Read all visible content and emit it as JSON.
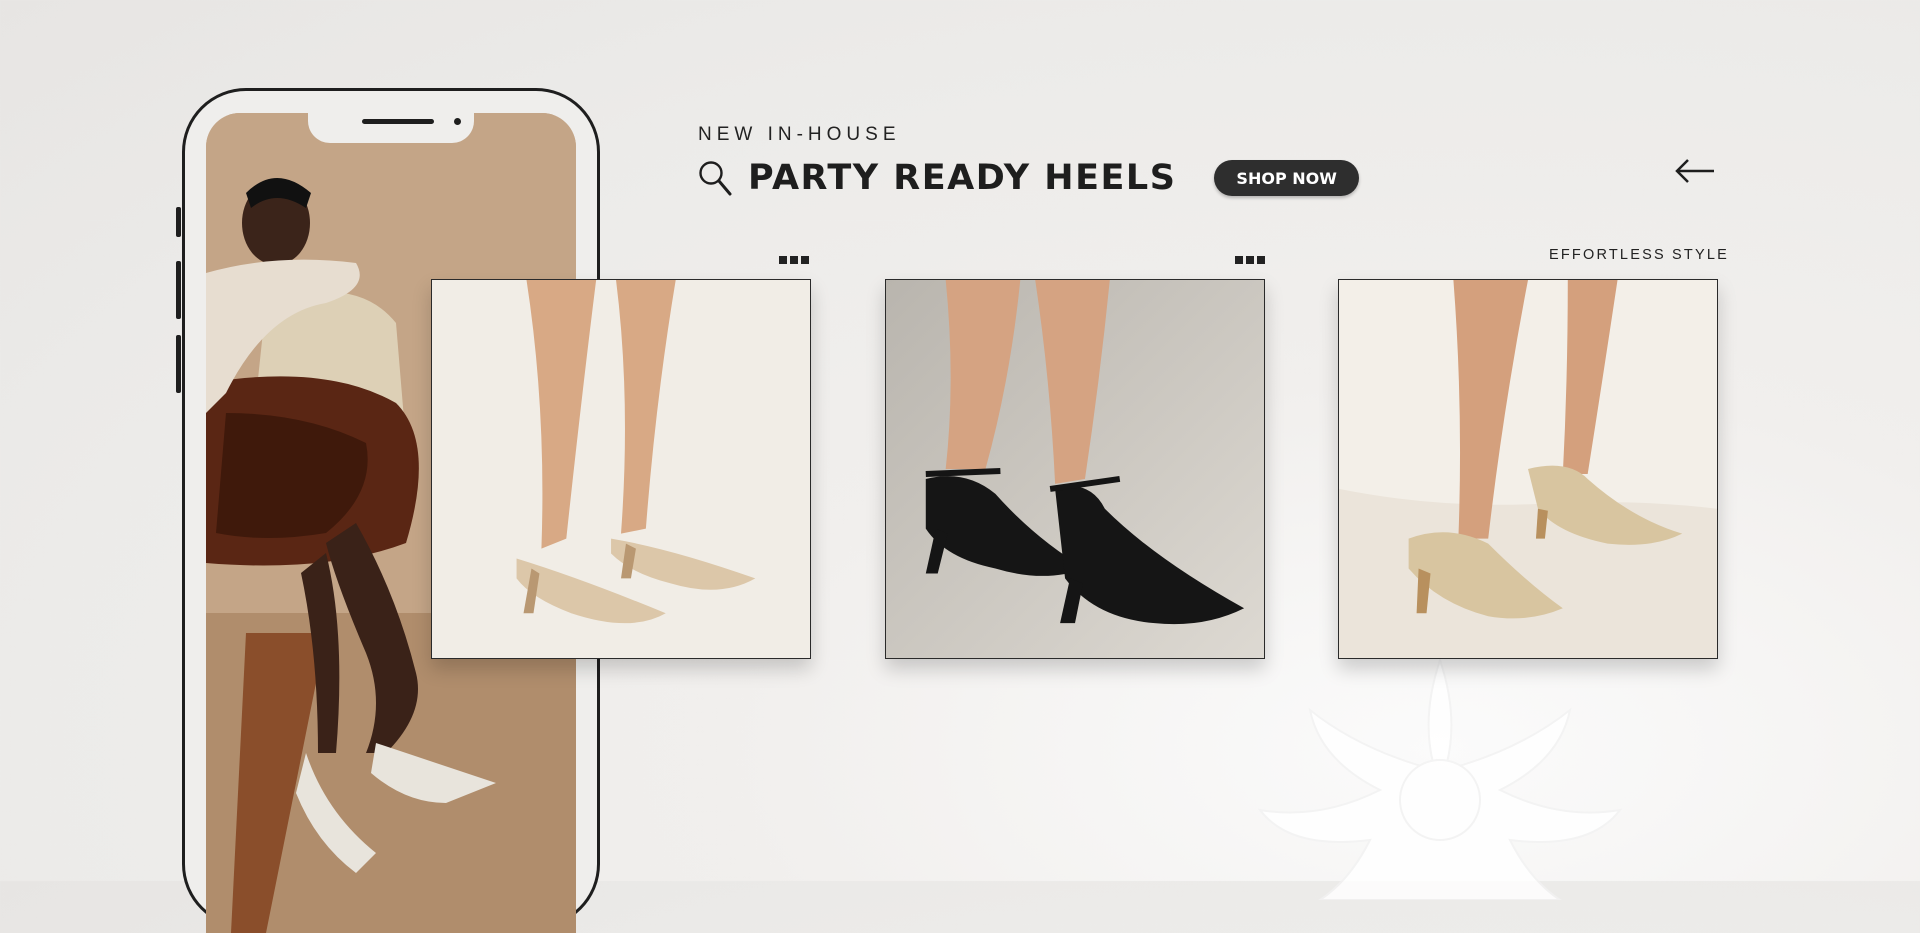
{
  "header": {
    "eyebrow": "NEW IN-HOUSE",
    "title": "PARTY READY HEELS",
    "shop_button_label": "SHOP NOW"
  },
  "caption": "EFFORTLESS STYLE",
  "icons": {
    "search": "search-icon",
    "back": "arrow-left-icon",
    "dots": "more-dots-icon"
  },
  "products": [
    {
      "name": "nude-mule-heels",
      "style": "strap mule, pointed toe",
      "color": "#d9c2a4"
    },
    {
      "name": "black-ankle-strap-heels",
      "style": "ankle strap pump",
      "color": "#1c1c1c"
    },
    {
      "name": "gold-slingback-heels",
      "style": "glitter slingback",
      "color": "#d8c9a8"
    }
  ],
  "colors": {
    "accent": "#2e2e2e",
    "background": "#ecebe9",
    "text": "#1e1e1e"
  }
}
